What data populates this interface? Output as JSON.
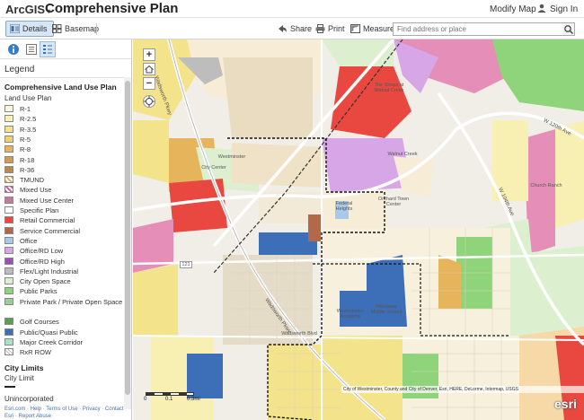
{
  "header": {
    "brand": "ArcGIS",
    "title": "Comprehensive Plan",
    "modify_map": "Modify Map",
    "sign_in": "Sign In"
  },
  "toolbar": {
    "details": "Details",
    "basemap": "Basemap",
    "share": "Share",
    "print": "Print",
    "measure": "Measure",
    "search_placeholder": "Find address or place"
  },
  "panel": {
    "legend_title": "Legend",
    "layer1_title": "Comprehensive Land Use Plan",
    "layer1_sub": "Land Use Plan",
    "items": [
      {
        "label": "R-1",
        "color": "#fbf7d8"
      },
      {
        "label": "R-2.5",
        "color": "#f8efb2"
      },
      {
        "label": "R-3.5",
        "color": "#f3e38a"
      },
      {
        "label": "R-5",
        "color": "#eed36a"
      },
      {
        "label": "R-8",
        "color": "#e6b45a"
      },
      {
        "label": "R-18",
        "color": "#d69a4e"
      },
      {
        "label": "R-36",
        "color": "#b98a4f"
      },
      {
        "label": "TMUND",
        "color": "#f7d9a8"
      },
      {
        "label": "Mixed Use",
        "color": "#e58fb8"
      },
      {
        "label": "Mixed Use Center",
        "color": "#c47a9c"
      },
      {
        "label": "Specific Plan",
        "color": "#ffffff"
      },
      {
        "label": "Retail Commercial",
        "color": "#e8483f"
      },
      {
        "label": "Service Commercial",
        "color": "#b36849"
      },
      {
        "label": "Office",
        "color": "#a9c7e8"
      },
      {
        "label": "Office/RD Low",
        "color": "#d7a6e6"
      },
      {
        "label": "Office/RD High",
        "color": "#9b4fb7"
      },
      {
        "label": "Flex/Light Industrial",
        "color": "#bdbdbd"
      },
      {
        "label": "City Open Space",
        "color": "#dcf0cf"
      },
      {
        "label": "Public Parks",
        "color": "#8fd47a"
      },
      {
        "label": "Private Park / Private Open Space",
        "color": "#9ccf98"
      },
      {
        "label": "Golf Courses",
        "color": "#5b9e52"
      },
      {
        "label": "Public/Quasi Public",
        "color": "#3d6fb8"
      },
      {
        "label": "Major Creek Corridor",
        "color": "#a8e2c8"
      },
      {
        "label": "RxR ROW",
        "color": "#eaeaea"
      }
    ],
    "layer2_title": "City Limits",
    "layer2_sub": "City Limit",
    "unincorporated": "Unincorporated",
    "footer": "Esri.com · Help · Terms of Use · Privacy · Contact Esri · Report Abuse"
  },
  "map": {
    "labels": {
      "church_north": "The Shops at Walnut Creek",
      "wadsworth": "Wadsworth Pkwy",
      "west_104": "W 104th Ave",
      "west_120": "W 120th Ave",
      "city_center": "City Center",
      "westminster": "Westminster",
      "walnut": "Walnut Creek",
      "church_ranch": "Church Ranch",
      "orchard": "Orchard Town Center",
      "federal_heights": "Federal Heights",
      "westm_acad": "Westminster Academy",
      "mandalay": "Mandalay Middle School",
      "pkwy_south": "Wadsworth Pkwy",
      "wadsworth_blvd": "Wadsworth Blvd",
      "hwy": "121"
    },
    "attribution": "City of Westminster, County and City of Denver, Esri, HERE, DeLorme, Intermap, USGS",
    "scale_labels": [
      "0",
      "0.1",
      "0.3mi"
    ],
    "esri_logo": "esri"
  }
}
